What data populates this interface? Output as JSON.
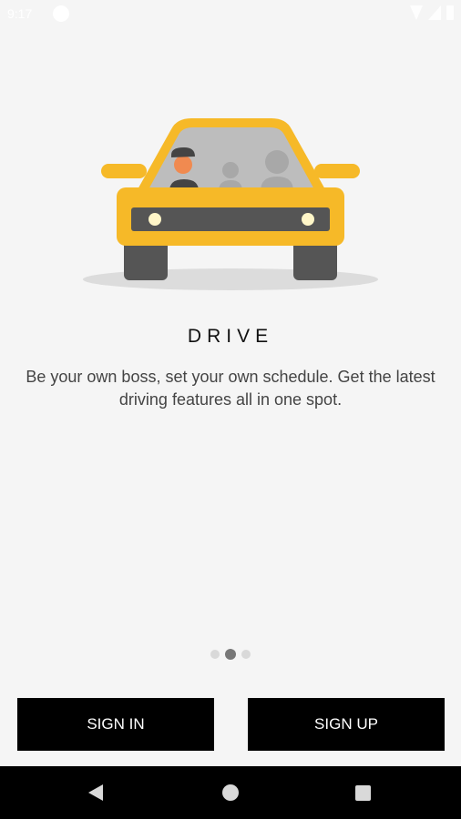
{
  "status_bar": {
    "time": "9:17",
    "icons": [
      "app-notification-icon",
      "wifi-icon",
      "signal-icon",
      "battery-icon"
    ]
  },
  "illustration": {
    "name": "taxi-car-illustration",
    "colors": {
      "body": "#f6b928",
      "dark": "#555555",
      "window": "#bdbdbd",
      "lights": "#fff6c8",
      "shadow": "#dcdcdc",
      "driver_face": "#f08a50"
    }
  },
  "onboarding": {
    "title": "DRIVE",
    "description": "Be your own boss, set your own schedule. Get the latest driving features all in one spot.",
    "page_indicator": {
      "count": 3,
      "active_index": 1
    }
  },
  "buttons": {
    "sign_in": "SIGN IN",
    "sign_up": "SIGN UP"
  },
  "nav_bar": {
    "icons": [
      "back-icon",
      "home-icon",
      "recents-icon"
    ]
  }
}
